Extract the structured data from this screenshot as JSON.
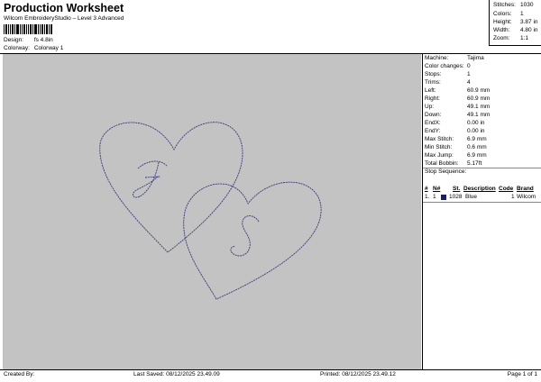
{
  "header": {
    "title": "Production Worksheet",
    "subtitle": "Wilcom EmbroideryStudio – Level 3 Advanced",
    "design_label": "Design:",
    "design_value": "fs 4.8in",
    "colorway_label": "Colorway:",
    "colorway_value": "Colorway 1"
  },
  "summary": {
    "stitches_label": "Stitches:",
    "stitches_value": "1030",
    "colors_label": "Colors:",
    "colors_value": "1",
    "height_label": "Height:",
    "height_value": "3.87 in",
    "width_label": "Width:",
    "width_value": "4.80 in",
    "zoom_label": "Zoom:",
    "zoom_value": "1:1"
  },
  "details": [
    {
      "label": "Machine:",
      "value": "Tajima"
    },
    {
      "label": "Color changes:",
      "value": "0"
    },
    {
      "label": "Stops:",
      "value": "1"
    },
    {
      "label": "Trims:",
      "value": "4"
    },
    {
      "label": "Left:",
      "value": "60.9 mm"
    },
    {
      "label": "Right:",
      "value": "60.9 mm"
    },
    {
      "label": "Up:",
      "value": "49.1 mm"
    },
    {
      "label": "Down:",
      "value": "49.1 mm"
    },
    {
      "label": "EndX:",
      "value": "0.00 in"
    },
    {
      "label": "EndY:",
      "value": "0.00 in"
    },
    {
      "label": "Max Stitch:",
      "value": "6.9 mm"
    },
    {
      "label": "Min Stitch:",
      "value": "0.6 mm"
    },
    {
      "label": "Max Jump:",
      "value": "6.9 mm"
    },
    {
      "label": "Total Bobbin:",
      "value": "5.17ft"
    }
  ],
  "stop_sequence": {
    "heading": "Stop Sequence:",
    "columns": {
      "hash": "#",
      "n": "N#",
      "st": "St.",
      "description": "Description",
      "code": "Code",
      "brand": "Brand"
    },
    "row": {
      "hash": "1.",
      "n": "1",
      "st": "1028",
      "description": "Blue",
      "code": "1",
      "brand": "Wilcom",
      "color": "#1c1c6b"
    }
  },
  "footer": {
    "created": "Created By:",
    "last_saved": "Last Saved: 08/12/2025 23.49.09",
    "printed": "Printed: 08/12/2025 23.49.12",
    "page": "Page 1 of 1"
  },
  "design": {
    "stitch_color": "#3a3a7a",
    "canvas_color": "#c3c3c3"
  }
}
